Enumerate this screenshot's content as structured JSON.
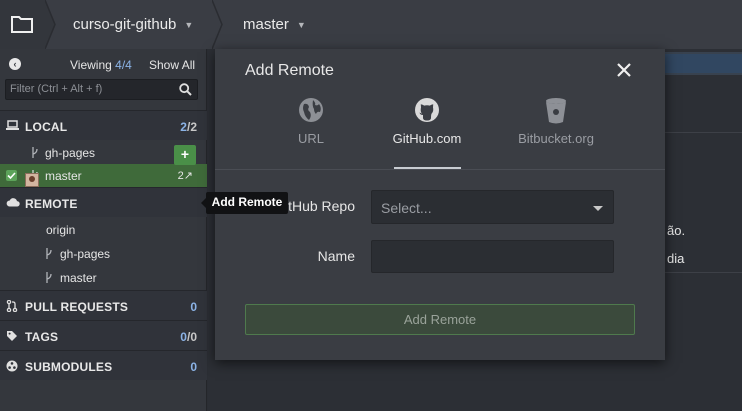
{
  "toolbar": {
    "repo_name": "curso-git-github",
    "branch_name": "master"
  },
  "sidebar": {
    "viewing_label": "Viewing",
    "viewing_count": "4/4",
    "show_all": "Show All",
    "filter_placeholder": "Filter (Ctrl + Alt + f)",
    "local": {
      "label": "LOCAL",
      "count_visible": "2",
      "count_total": "/2",
      "branches": [
        {
          "name": "gh-pages"
        },
        {
          "name": "master",
          "sync": "2↗"
        }
      ]
    },
    "remote": {
      "label": "REMOTE",
      "add_button": "+",
      "remote_name": "origin",
      "branches": [
        {
          "name": "gh-pages"
        },
        {
          "name": "master"
        }
      ]
    },
    "pull_requests": {
      "label": "PULL REQUESTS",
      "count": "0"
    },
    "tags": {
      "label": "TAGS",
      "count_visible": "0",
      "count_total": "/0"
    },
    "submodules": {
      "label": "SUBMODULES",
      "count": "0"
    }
  },
  "tooltip": "Add Remote",
  "main": {
    "line1": "ão.",
    "line2": "dia"
  },
  "modal": {
    "title": "Add Remote",
    "tabs": [
      {
        "label": "URL",
        "icon": "globe-icon"
      },
      {
        "label": "GitHub.com",
        "icon": "github-icon"
      },
      {
        "label": "Bitbucket.org",
        "icon": "bitbucket-icon"
      }
    ],
    "selected_tab": "GitHub.com",
    "repo_label": "GitHub Repo",
    "repo_placeholder": "Select...",
    "name_label": "Name",
    "name_value": "",
    "submit_label": "Add Remote"
  },
  "colors": {
    "accent_green": "#4a8f48",
    "active_branch_bg": "#3f6a3a",
    "count_blue": "#8bb3e6"
  }
}
